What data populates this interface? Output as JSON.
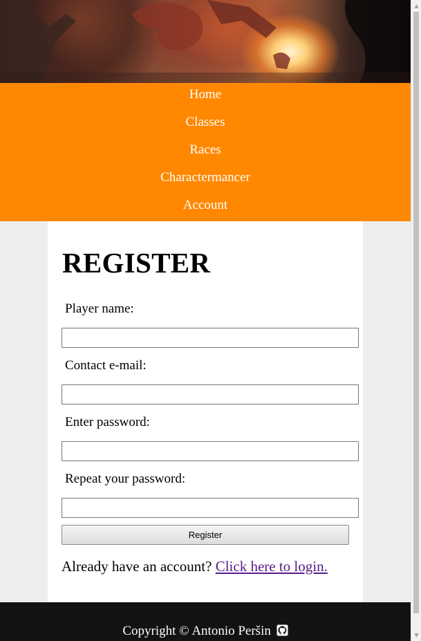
{
  "nav": {
    "items": [
      {
        "label": "Home"
      },
      {
        "label": "Classes"
      },
      {
        "label": "Races"
      },
      {
        "label": "Charactermancer"
      },
      {
        "label": "Account"
      }
    ]
  },
  "form": {
    "title": "REGISTER",
    "player_name_label": "Player name:",
    "player_name_value": "",
    "email_label": "Contact e-mail:",
    "email_value": "",
    "password_label": "Enter password:",
    "password_value": "",
    "repeat_label": "Repeat your password:",
    "repeat_value": "",
    "submit_label": "Register",
    "login_prompt": "Already have an account?",
    "login_link": "Click here to login."
  },
  "footer": {
    "copyright": "Copyright © Antonio Peršin",
    "icon": "github-icon"
  },
  "colors": {
    "nav_bg": "#ff8800",
    "footer_bg": "#141212",
    "link": "#551a8b",
    "page_bg": "#ededed"
  }
}
